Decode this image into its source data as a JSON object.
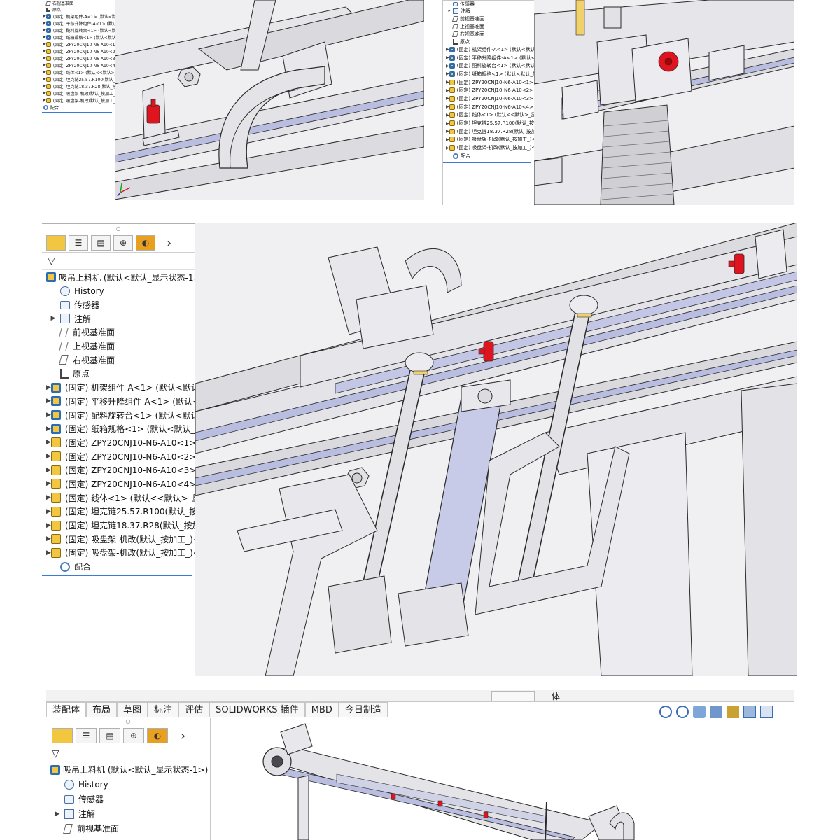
{
  "tree_root": "吸吊上料机 (默认<默认_显示状态-1>)",
  "history": "History",
  "sensors": "传感器",
  "annotations": "注解",
  "front_plane": "前视基准面",
  "top_plane": "上视基准面",
  "right_plane": "右视基准面",
  "origin": "原点",
  "components_p3": [
    "(固定) 机架组件-A<1> (默认<默认_",
    "(固定) 平移升降组件-A<1> (默认<默",
    "(固定) 配料旋转台<1> (默认<默认_",
    "(固定) 纸箱规格<1> (默认<默认_显",
    "(固定) ZPY20CNJ10-N6-A10<1> (",
    "(固定) ZPY20CNJ10-N6-A10<2> (",
    "(固定) ZPY20CNJ10-N6-A10<3> (",
    "(固定) ZPY20CNJ10-N6-A10<4> (",
    "(固定) 线体<1> (默认<<默认>_显示",
    "(固定) 坦克链25.57.R100(默认_按加",
    "(固定) 坦克链18.37.R28(默认_按加工",
    "(固定) 吸盘架-机改(默认_按加工_)<",
    "(固定) 吸盘架-机改(默认_按加工_)<2"
  ],
  "components_p1": [
    "(固定) 机架组件-A<1> (默认<默认",
    "(固定) 平移升降组件-A<1> (默认<",
    "(固定) 配料旋转台<1> (默认<默认_",
    "(固定) 纸箱规格<1> (默认<默认_显",
    "(固定) ZPY20CNJ10-N6-A10<1> (",
    "(固定) ZPY20CNJ10-N6-A10<2> (",
    "(固定) ZPY20CNJ10-N6-A10<3> (",
    "(固定) ZPY20CNJ10-N6-A10<4> (",
    "(固定) 线体<1> (默认<<默认>_显",
    "(固定) 坦克链25.57.R100(默认_按加",
    "(固定) 坦克链18.37.R28(默认_按加",
    "(固定) 吸盘架-机改(默认_按加工_)<",
    "(固定) 吸盘架-机改(默认_按加工_)<"
  ],
  "components_p2": [
    "(固定) 机架组件-A<1> (默认<默认_",
    "(固定) 平移升降组件-A<1> (默认<默",
    "(固定) 配料旋转台<1> (默认<默认_",
    "(固定) 纸箱规格<1> (默认<默认_显",
    "(固定) ZPY20CNJ10-N6-A10<1> (",
    "(固定) ZPY20CNJ10-N6-A10<2> (",
    "(固定) ZPY20CNJ10-N6-A10<3> (",
    "(固定) ZPY20CNJ10-N6-A10<4> (",
    "(固定) 线体<1> (默认<<默认>_显",
    "(固定) 坦克链25.57.R100(默认_按加",
    "(固定) 坦克链18.37.R28(默认_按加",
    "(固定) 吸盘架-机改(默认_按加工_)<",
    "(固定) 吸盘架-机改(默认_按加工_)<"
  ],
  "mates": "配合",
  "p2_top": "传感器",
  "p1_top": "右视基准面",
  "cmd_tabs": [
    "装配体",
    "布局",
    "草图",
    "标注",
    "评估",
    "SOLIDWORKS 插件",
    "MBD",
    "今日制造"
  ],
  "toolbar_text": "体",
  "chevron": "›",
  "colors": {
    "part_metal": "#dcdce0",
    "edge": "#2a2a2a",
    "highlight_red": "#e0141e",
    "rail_blue": "#b9bde0",
    "tree_bg": "#ffffff"
  }
}
